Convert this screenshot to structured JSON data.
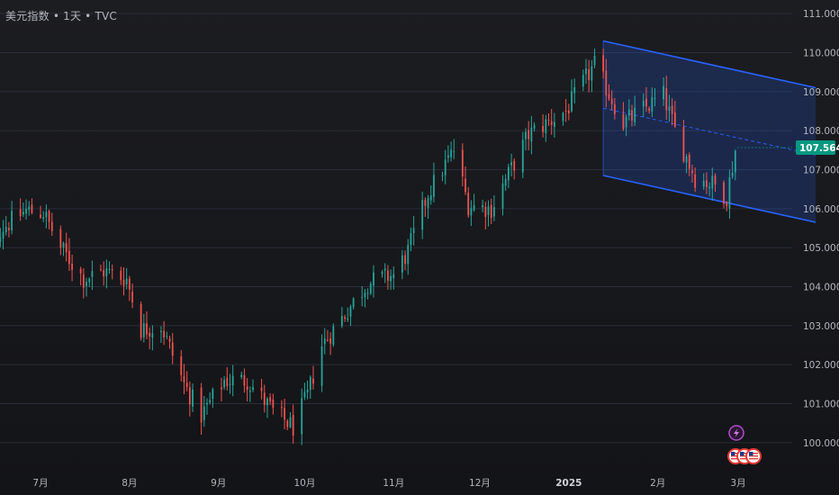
{
  "title": "美元指数 • 1天 • TVC",
  "current_price_label": "107.564",
  "colors": {
    "background": "#17181c",
    "up": "#26a69a",
    "down": "#ef5350",
    "channel_line": "#2962ff",
    "channel_fill": "#2962ff",
    "price_tag": "#089981",
    "grid": "#2a2e39",
    "text": "#b2b5be"
  },
  "icons": {
    "lightning": "lightning-icon",
    "us_flags": [
      "us-flag-icon",
      "us-flag-icon",
      "us-flag-icon"
    ]
  },
  "chart_data": {
    "type": "candlestick",
    "y_ticks": [
      "100.000",
      "101.000",
      "102.000",
      "103.000",
      "104.000",
      "105.000",
      "106.000",
      "107.000",
      "108.000",
      "109.000",
      "110.000",
      "111.000"
    ],
    "ylim": [
      99.35,
      111.35
    ],
    "x_ticks": [
      {
        "label": "7月",
        "date": "2024-07-01"
      },
      {
        "label": "8月",
        "date": "2024-08-01"
      },
      {
        "label": "9月",
        "date": "2024-09-01"
      },
      {
        "label": "10月",
        "date": "2024-10-01"
      },
      {
        "label": "11月",
        "date": "2024-11-01"
      },
      {
        "label": "12月",
        "date": "2024-12-01"
      },
      {
        "label": "2025",
        "date": "2025-01-01",
        "bold": true
      },
      {
        "label": "2月",
        "date": "2025-02-01"
      },
      {
        "label": "3月",
        "date": "2025-03-01"
      }
    ],
    "series_close_anchors": [
      {
        "date": "2024-06-10",
        "close": 105.1
      },
      {
        "date": "2024-06-26",
        "close": 105.95
      },
      {
        "date": "2024-07-02",
        "close": 105.9
      },
      {
        "date": "2024-07-08",
        "close": 105.0
      },
      {
        "date": "2024-07-16",
        "close": 104.2
      },
      {
        "date": "2024-07-23",
        "close": 104.4
      },
      {
        "date": "2024-07-31",
        "close": 104.2
      },
      {
        "date": "2024-08-05",
        "close": 102.9
      },
      {
        "date": "2024-08-12",
        "close": 103.0
      },
      {
        "date": "2024-08-20",
        "close": 101.5
      },
      {
        "date": "2024-08-26",
        "close": 100.7
      },
      {
        "date": "2024-09-03",
        "close": 101.6
      },
      {
        "date": "2024-09-11",
        "close": 101.6
      },
      {
        "date": "2024-09-20",
        "close": 100.8
      },
      {
        "date": "2024-09-27",
        "close": 100.4
      },
      {
        "date": "2024-10-02",
        "close": 101.2
      },
      {
        "date": "2024-10-07",
        "close": 102.5
      },
      {
        "date": "2024-10-15",
        "close": 103.3
      },
      {
        "date": "2024-10-23",
        "close": 104.1
      },
      {
        "date": "2024-11-01",
        "close": 104.3
      },
      {
        "date": "2024-11-06",
        "close": 104.9
      },
      {
        "date": "2024-11-13",
        "close": 106.4
      },
      {
        "date": "2024-11-22",
        "close": 107.5
      },
      {
        "date": "2024-11-27",
        "close": 106.1
      },
      {
        "date": "2024-12-05",
        "close": 106.0
      },
      {
        "date": "2024-12-18",
        "close": 107.9
      },
      {
        "date": "2024-12-31",
        "close": 108.5
      },
      {
        "date": "2025-01-10",
        "close": 109.7
      },
      {
        "date": "2025-01-20",
        "close": 108.2
      },
      {
        "date": "2025-02-03",
        "close": 108.9
      },
      {
        "date": "2025-02-07",
        "close": 108.0
      },
      {
        "date": "2025-02-14",
        "close": 106.8
      },
      {
        "date": "2025-02-21",
        "close": 106.6
      },
      {
        "date": "2025-02-25",
        "close": 106.3
      },
      {
        "date": "2025-02-28",
        "close": 107.5
      }
    ],
    "channel": {
      "start": {
        "date": "2025-01-13",
        "upper": 110.3,
        "lower": 106.85
      },
      "end": {
        "date": "2025-03-28",
        "upper": 109.1,
        "lower": 105.65
      }
    },
    "last_price": 107.564
  }
}
